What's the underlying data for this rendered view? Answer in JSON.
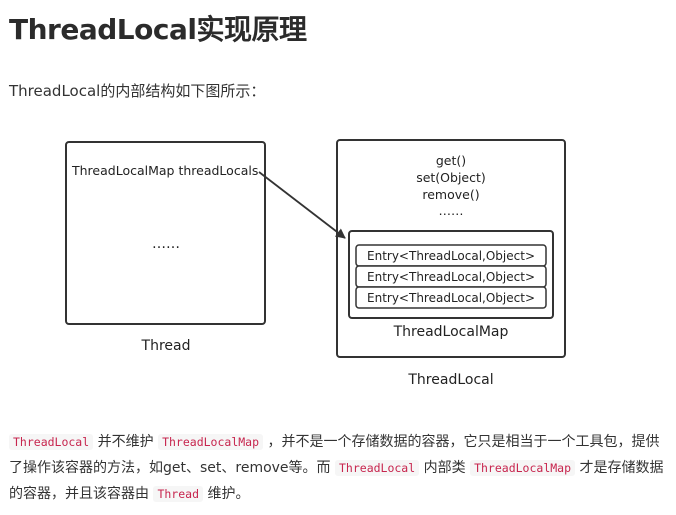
{
  "heading": "ThreadLocal实现原理",
  "intro": "ThreadLocal的内部结构如下图所示：",
  "diagram": {
    "thread_box": {
      "field": "ThreadLocalMap threadLocals",
      "ellipsis": "……",
      "label": "Thread"
    },
    "threadlocal_box": {
      "methods": [
        "get()",
        "set(Object)",
        "remove()",
        "……"
      ],
      "map": {
        "entries": [
          "Entry<ThreadLocal,Object>",
          "Entry<ThreadLocal,Object>",
          "Entry<ThreadLocal,Object>"
        ],
        "label": "ThreadLocalMap"
      },
      "label": "ThreadLocal"
    }
  },
  "paragraph": {
    "code1": "ThreadLocal",
    "text1": " 并不维护 ",
    "code2": "ThreadLocalMap",
    "text2": " ，并不是一个存储数据的容器，它只是相当于一个工具包，提供了操作该容器的方法，如get、set、remove等。而 ",
    "code3": "ThreadLocal",
    "text3": " 内部类 ",
    "code4": "ThreadLocalMap",
    "text4": " 才是存储数据的容器，并且该容器由 ",
    "code5": "Thread",
    "text5": " 维护。"
  },
  "colors": {
    "code_text": "#c7254e",
    "code_bg": "#f6f6f6",
    "box_stroke": "#333333"
  }
}
